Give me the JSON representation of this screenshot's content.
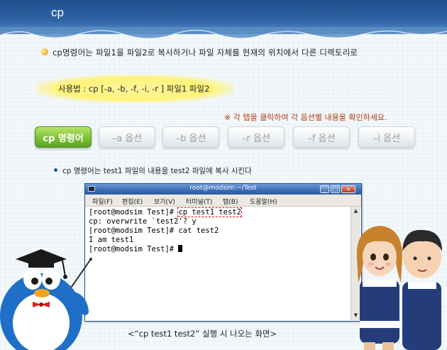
{
  "header": {
    "title": "cp"
  },
  "intro": {
    "text": "cp명령어는 파일1을 파일2로 복사하거나 파일 자체를 현재의 위치에서 다른 디렉토리로"
  },
  "usage": {
    "text": "사용법 : cp [-a, -b, -f, -i, -r ] 파일1 파일2"
  },
  "note": {
    "text": "※ 각 탭을 클릭하여 각 옵션별 내용을 확인하세요."
  },
  "tabs": [
    {
      "label": "cp 명령어",
      "active": true
    },
    {
      "label": "–a 옵션",
      "active": false
    },
    {
      "label": "–b 옵션",
      "active": false
    },
    {
      "label": "–r 옵션",
      "active": false
    },
    {
      "label": "–f 옵션",
      "active": false
    },
    {
      "label": "–i 옵션",
      "active": false
    }
  ],
  "description": {
    "text": "cp 명령어는 test1 파일의 내용을  test2 파일에 복사 시킨다"
  },
  "terminal": {
    "title": "root@modsim:~/Test",
    "menu": [
      "파일(F)",
      "편집(E)",
      "보기(V)",
      "터미널(T)",
      "탭(B)",
      "도움말(H)"
    ],
    "prompt1": "[root@modsim Test]# ",
    "command1": "cp test1 test2",
    "line2": "cp: overwrite `test2'? y",
    "line3": "[root@modsim Test]# cat test2",
    "line4": "I am test1",
    "prompt5": "[root@modsim Test]# "
  },
  "caption": {
    "text": "<“cp test1 test2” 실행 시 나오는 화면>"
  },
  "colors": {
    "accent_green": "#7cc238",
    "header_blue": "#2e64a6",
    "note_orange": "#b04010"
  }
}
